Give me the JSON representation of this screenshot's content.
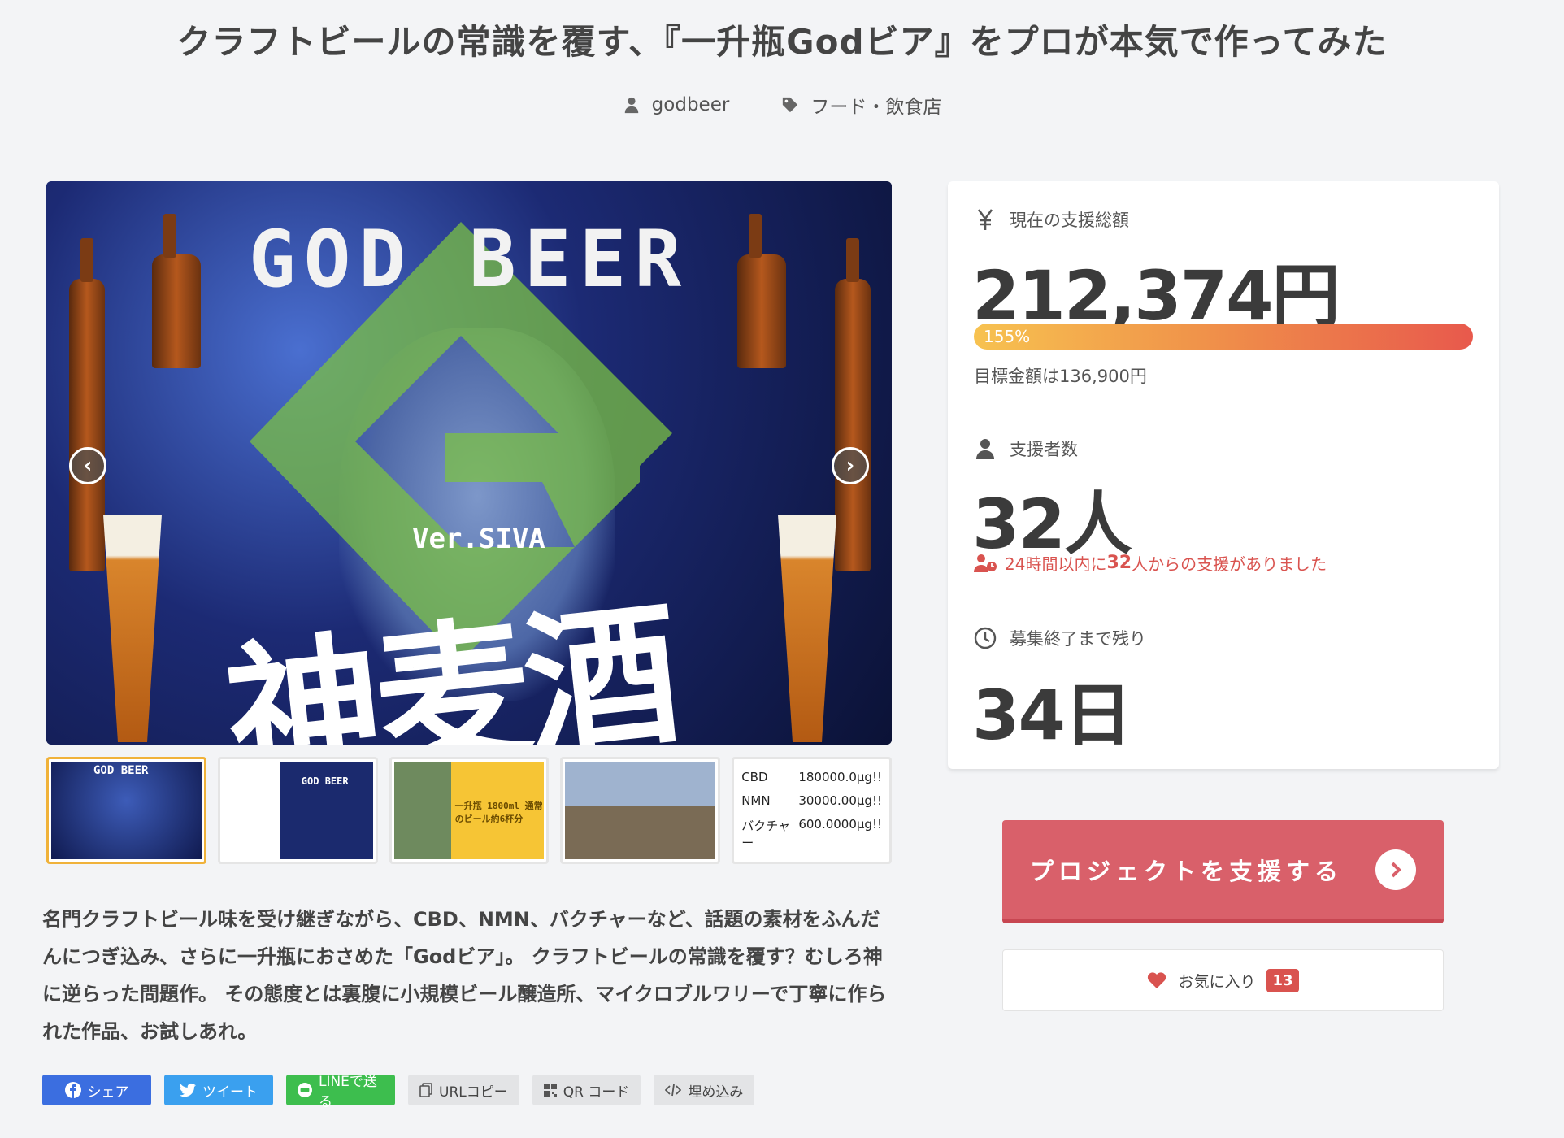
{
  "header": {
    "title": "クラフトビールの常識を覆す、『一升瓶Godビア』をプロが本気で作ってみた",
    "author": "godbeer",
    "category": "フード・飲食店"
  },
  "gallery": {
    "main_image": {
      "title_text": "GOD BEER",
      "version_text": "Ver.SIVA",
      "kanji_text": "神麦酒"
    },
    "prev_arrow": "‹",
    "next_arrow": "›",
    "thumbs": [
      {
        "label": "GOD BEER"
      },
      {
        "label": "GOD BEER"
      },
      {
        "label": "一升瓶 1800ml 通常のビール約6杯分"
      },
      {
        "label": ""
      },
      {
        "rows": [
          {
            "name": "CBD",
            "value": "180000.0μg!!"
          },
          {
            "name": "NMN",
            "value": "30000.00μg!!"
          },
          {
            "name": "バクチャー",
            "value": "600.0000μg!!"
          }
        ]
      }
    ]
  },
  "description": "名門クラフトビール味を受け継ぎながら、CBD、NMN、バクチャーなど、話題の素材をふんだんにつぎ込み、さらに一升瓶におさめた「Godビア」。 クラフトビールの常識を覆す？むしろ神に逆らった問題作。 その態度とは裏腹に小規模ビール醸造所、マイクロブルワリーで丁寧に作られた作品、お試しあれ。",
  "share": {
    "facebook": "シェア",
    "twitter": "ツイート",
    "line": "LINEで送る",
    "url_copy": "URLコピー",
    "qr": "QR コード",
    "embed": "埋め込み"
  },
  "stats": {
    "amount_label": "現在の支援総額",
    "amount": "212,374円",
    "progress_text": "155%",
    "progress_pct": 155,
    "target_text": "目標金額は136,900円",
    "backers_label": "支援者数",
    "backers": "32人",
    "recent_prefix": "24時間以内に",
    "recent_count": "32",
    "recent_suffix": "人からの支援がありました",
    "remaining_label": "募集終了まで残り",
    "remaining": "34日"
  },
  "actions": {
    "support_label": "プロジェクトを支援する",
    "favorite_label": "お気に入り",
    "favorite_count": "13"
  },
  "colors": {
    "accent": "#d9606a",
    "alert": "#d9534f",
    "progress_start": "#f7c250",
    "progress_end": "#e8594c"
  }
}
